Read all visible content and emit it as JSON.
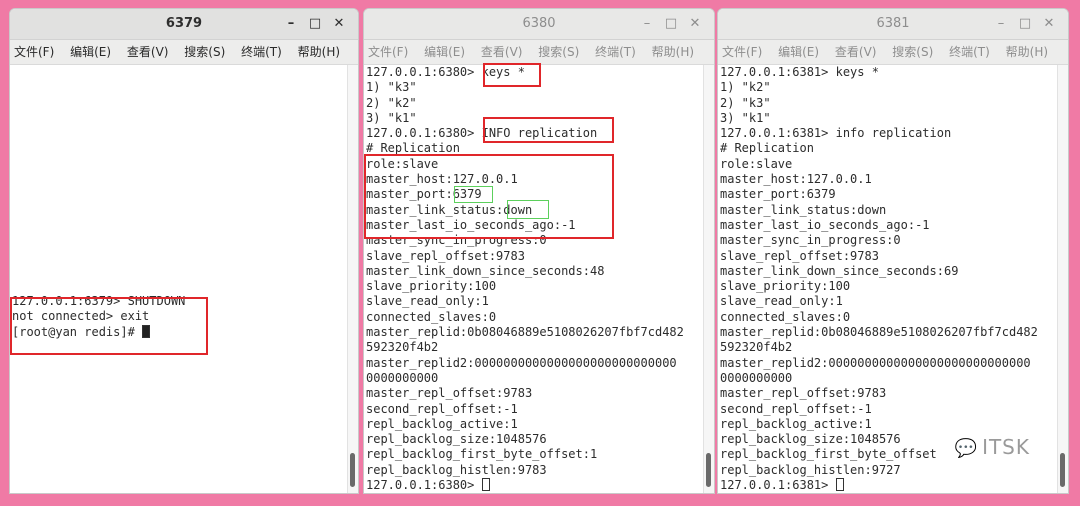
{
  "windows": [
    {
      "title": "6379",
      "menu": [
        "文件(F)",
        "编辑(E)",
        "查看(V)",
        "搜索(S)",
        "终端(T)",
        "帮助(H)"
      ],
      "lines": [
        "127.0.0.1:6379> SHUTDOWN",
        "not connected> exit",
        "[root@yan redis]# "
      ]
    },
    {
      "title": "6380",
      "menu": [
        "文件(F)",
        "编辑(E)",
        "查看(V)",
        "搜索(S)",
        "终端(T)",
        "帮助(H)"
      ],
      "lines": [
        "127.0.0.1:6380> keys *",
        "1) \"k3\"",
        "2) \"k2\"",
        "3) \"k1\"",
        "127.0.0.1:6380> INFO replication",
        "# Replication",
        "role:slave",
        "master_host:127.0.0.1",
        "master_port:6379",
        "master_link_status:down",
        "master_last_io_seconds_ago:-1",
        "master_sync_in_progress:0",
        "slave_repl_offset:9783",
        "master_link_down_since_seconds:48",
        "slave_priority:100",
        "slave_read_only:1",
        "connected_slaves:0",
        "master_replid:0b08046889e5108026207fbf7cd482",
        "592320f4b2",
        "master_replid2:0000000000000000000000000000",
        "0000000000",
        "master_repl_offset:9783",
        "second_repl_offset:-1",
        "repl_backlog_active:1",
        "repl_backlog_size:1048576",
        "repl_backlog_first_byte_offset:1",
        "repl_backlog_histlen:9783",
        "127.0.0.1:6380> "
      ]
    },
    {
      "title": "6381",
      "menu": [
        "文件(F)",
        "编辑(E)",
        "查看(V)",
        "搜索(S)",
        "终端(T)",
        "帮助(H)"
      ],
      "lines": [
        "127.0.0.1:6381> keys *",
        "1) \"k2\"",
        "2) \"k3\"",
        "3) \"k1\"",
        "127.0.0.1:6381> info replication",
        "# Replication",
        "role:slave",
        "master_host:127.0.0.1",
        "master_port:6379",
        "master_link_status:down",
        "master_last_io_seconds_ago:-1",
        "master_sync_in_progress:0",
        "slave_repl_offset:9783",
        "master_link_down_since_seconds:69",
        "slave_priority:100",
        "slave_read_only:1",
        "connected_slaves:0",
        "master_replid:0b08046889e5108026207fbf7cd482",
        "592320f4b2",
        "master_replid2:0000000000000000000000000000",
        "0000000000",
        "master_repl_offset:9783",
        "second_repl_offset:-1",
        "repl_backlog_active:1",
        "repl_backlog_size:1048576",
        "repl_backlog_first_byte_offset",
        "repl_backlog_histlen:9727",
        "127.0.0.1:6381> "
      ]
    }
  ],
  "controls": {
    "min": "–",
    "max": "□",
    "close": "✕"
  },
  "icons": {
    "min": "minimize-icon",
    "max": "maximize-icon",
    "close": "close-icon",
    "watermark": "wechat-icon"
  },
  "watermark": {
    "text": "ITSK"
  },
  "colors": {
    "background": "#f07aa5",
    "highlight_red": "#e0262a",
    "highlight_green": "#5cd05c"
  }
}
